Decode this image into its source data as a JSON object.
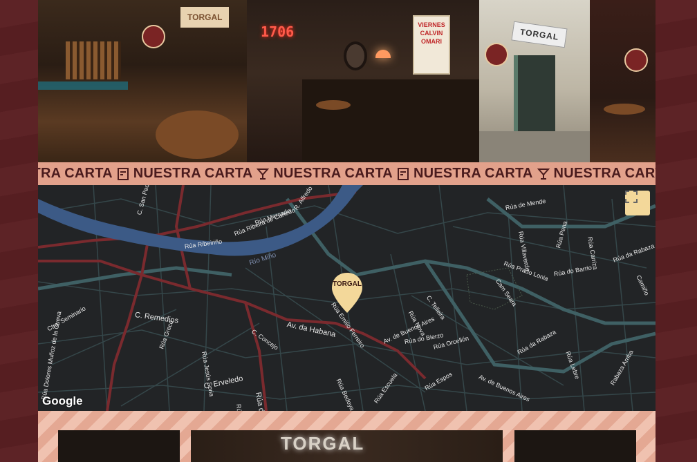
{
  "photos": {
    "torgal_poster_text": "TORGAL",
    "neon_text": "1706",
    "storefront_sign": "TORGAL",
    "poster_lines": [
      "VIERNES",
      "CALVIN",
      "OMARI"
    ]
  },
  "marquee": {
    "items": [
      {
        "text": "NUESTRA CARTA",
        "icon": "menu-icon"
      },
      {
        "text": "NUESTRA CARTA",
        "icon": "cocktail-icon"
      },
      {
        "text": "NUESTRA CARTA",
        "icon": "menu-icon"
      },
      {
        "text": "NUESTRA CARTA",
        "icon": "cocktail-icon"
      },
      {
        "text": "NUESTRA CARTA",
        "icon": "menu-icon"
      }
    ],
    "leading_fragment": "STRA CARTA"
  },
  "map": {
    "marker_label": "TORGAL",
    "google_logo": "Google",
    "streets": [
      "C. San Pedro",
      "Rúa Mercado",
      "R. Alfredo",
      "Rúa Ribeira de Canedo",
      "Rúa Ribeiriño",
      "Río Miño",
      "Rúa de Mende",
      "Rúa Villaverde",
      "Rúa Prado Lonia",
      "Rúa Pena",
      "Rúa Carriza",
      "Rúa da Rabaza",
      "Camiño",
      "Cam Seara",
      "Rúa do Barrio",
      "C. Remedios",
      "Ctra. Seminario",
      "Av. da Habana",
      "Rúa Emilio Ferreiro",
      "C. Concejo",
      "Rúa Greco",
      "Av. de Buenos Aires",
      "Rúa do Bierzo",
      "Rúa Orcellón",
      "Rúa Nova",
      "C. Telleira",
      "Rúa Jesús Soria",
      "C. Erveledo",
      "Rúa do",
      "Rúa Bedoya",
      "Rúa Escuela",
      "Rúa Nuño de Osuende",
      "Rúa Lebre",
      "Rúa Espos",
      "Av. de Buenos Aires",
      "Rúa Dolores Muñoz de la Cueva",
      "Rúa Doutor",
      "Rúa da Rabaza",
      "Rabaza Arriba"
    ]
  },
  "bottom": {
    "card_sign": "TORGAL"
  },
  "colors": {
    "background": "#5a1f22",
    "marquee_bg": "#e2a18b",
    "marquee_text": "#4a1b1d",
    "map_bg": "#222426",
    "river": "#3c5a86",
    "roads_major": "#7a2a2e",
    "roads_minor": "#3f5a5a",
    "marker": "#f3d89a"
  }
}
